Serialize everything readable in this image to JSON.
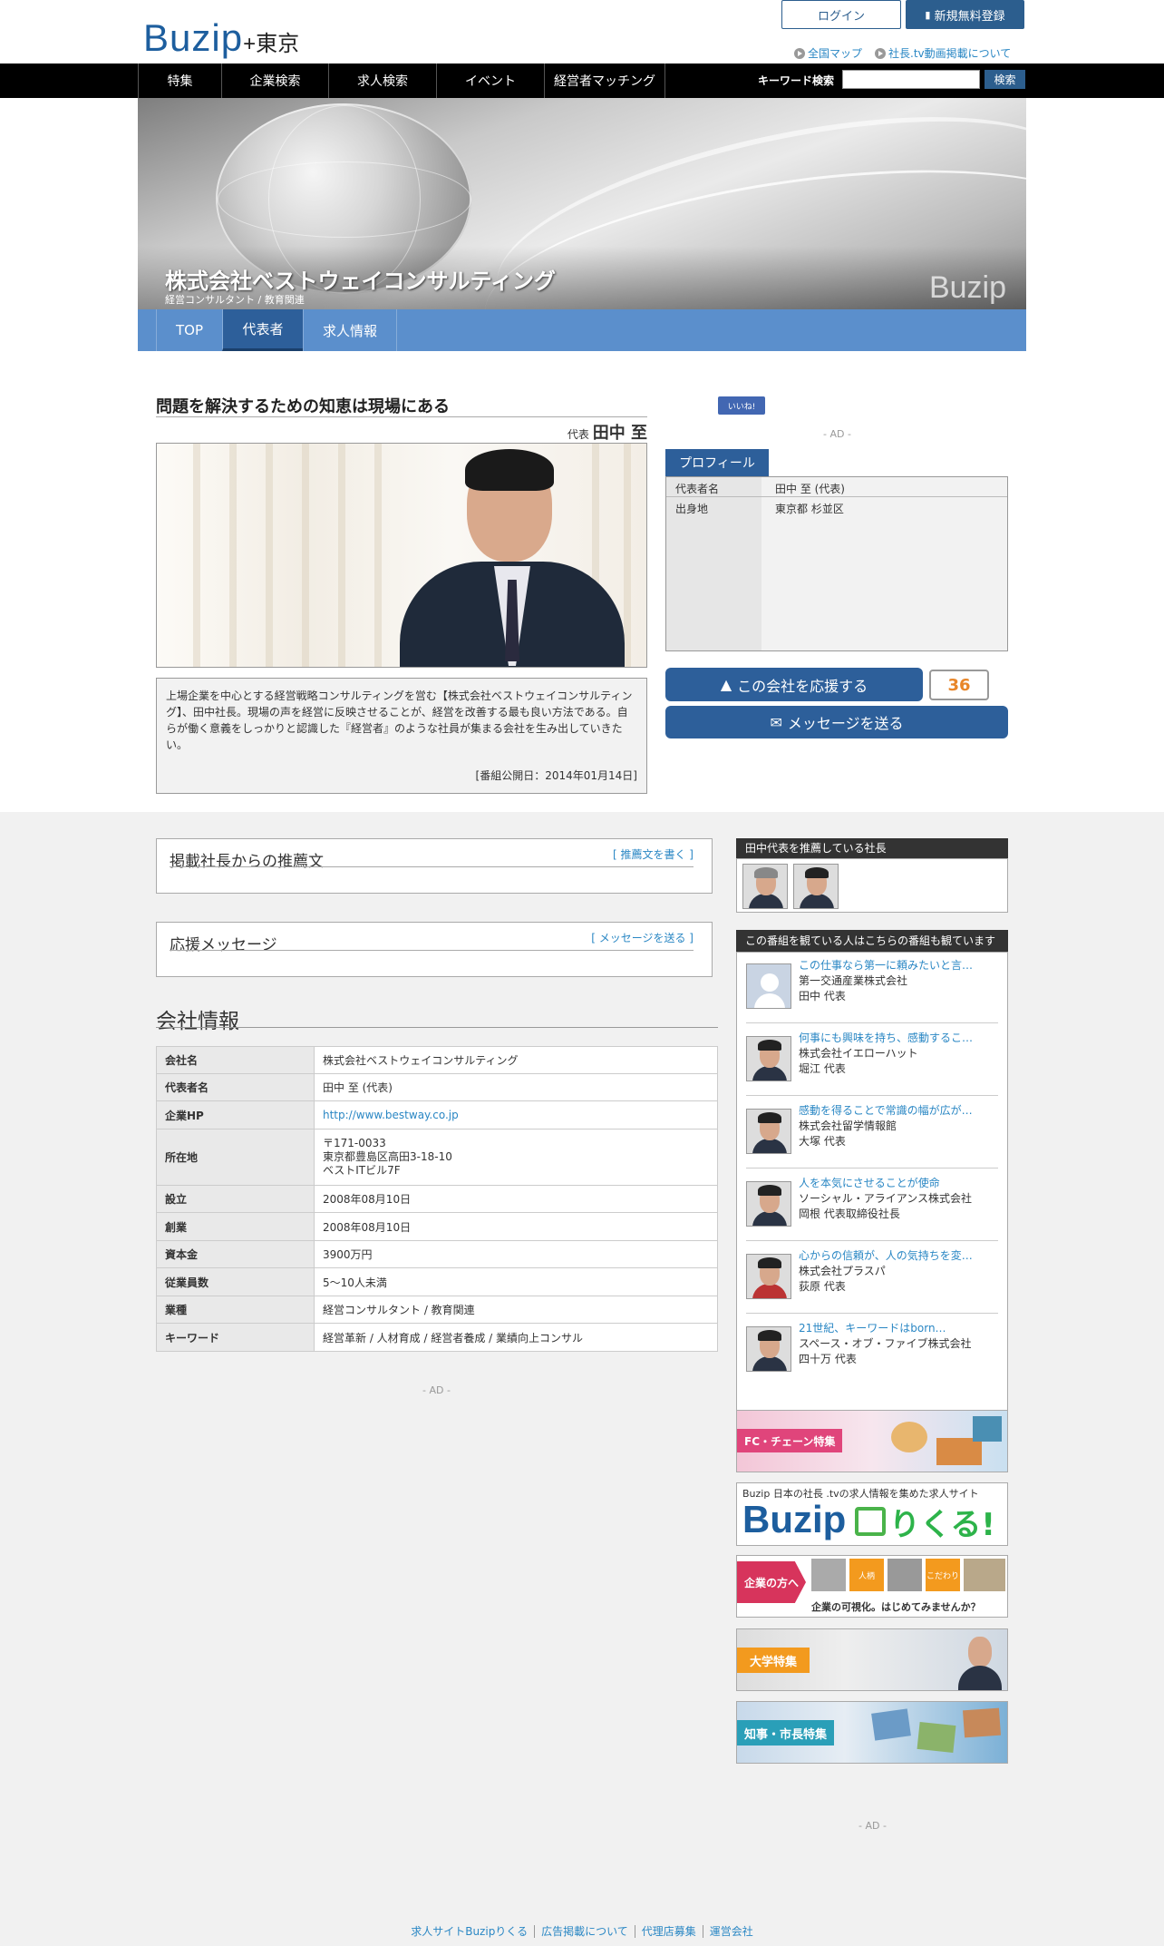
{
  "header": {
    "logo_main": "Buzip",
    "logo_plus": "+東京",
    "login_label": "ログイン",
    "register_label": "新規無料登録",
    "link_map": "全国マップ",
    "link_tv": "社長.tv動画掲載について"
  },
  "nav": {
    "items": [
      "特集",
      "企業検索",
      "求人検索",
      "イベント",
      "経営者マッチング"
    ],
    "keyword_label": "キーワード検索",
    "search_button": "検索",
    "search_value": ""
  },
  "hero": {
    "company": "株式会社ベストウェイコンサルティング",
    "category": "経営コンサルタント / 教育関連",
    "watermark": "Buzip"
  },
  "tabs": [
    "TOP",
    "代表者",
    "求人情報"
  ],
  "main": {
    "headline": "問題を解決するための知恵は現場にある",
    "rep_prefix": "代表",
    "rep_name": "田中 至",
    "description": "上場企業を中心とする経営戦略コンサルティングを営む【株式会社ベストウェイコンサルティング】、田中社長。現場の声を経営に反映させることが、経営を改善する最も良い方法である。自らが働く意義をしっかりと認識した『経営者』のような社員が集まる会社を生み出していきたい。",
    "date": "[番組公開日：2014年01月14日]"
  },
  "sidebar_top": {
    "like_label": "いいね!",
    "ad": "- AD -",
    "profile_tab": "プロフィール",
    "profile": [
      {
        "k": "代表者名",
        "v": "田中 至 (代表)"
      },
      {
        "k": "出身地",
        "v": "東京都 杉並区"
      }
    ],
    "support_label": "この会社を応援する",
    "support_count": "36",
    "message_label": "メッセージを送る"
  },
  "recommend": {
    "title": "掲載社長からの推薦文",
    "link": "[ 推薦文を書く ]"
  },
  "cheer": {
    "title": "応援メッセージ",
    "link": "[ メッセージを送る ]"
  },
  "company": {
    "title": "会社情報",
    "rows": [
      {
        "k": "会社名",
        "v": "株式会社ベストウェイコンサルティング"
      },
      {
        "k": "代表者名",
        "v": "田中 至 (代表)"
      },
      {
        "k": "企業HP",
        "v": "http://www.bestway.co.jp"
      },
      {
        "k": "所在地",
        "v": "〒171-0033\n東京都豊島区高田3-18-10\nベストITビル7F"
      },
      {
        "k": "設立",
        "v": "2008年08月10日"
      },
      {
        "k": "創業",
        "v": "2008年08月10日"
      },
      {
        "k": "資本金",
        "v": "3900万円"
      },
      {
        "k": "従業員数",
        "v": "5〜10人未満"
      },
      {
        "k": "業種",
        "v": "経営コンサルタント / 教育関連"
      },
      {
        "k": "キーワード",
        "v": "経営革新 / 人材育成 / 経営者養成 / 業績向上コンサル"
      }
    ],
    "ad": "- AD -"
  },
  "side": {
    "recommenders_title": "田中代表を推薦している社長",
    "watching_title": "この番組を観ている人はこちらの番組も観ています",
    "watching": [
      {
        "title": "この仕事なら第一に頼みたいと言…",
        "company": "第一交通産業株式会社",
        "name": "田中 代表"
      },
      {
        "title": "何事にも興味を持ち、感動するこ…",
        "company": "株式会社イエローハット",
        "name": "堀江 代表"
      },
      {
        "title": "感動を得ることで常識の幅が広が…",
        "company": "株式会社留学情報館",
        "name": "大塚 代表"
      },
      {
        "title": "人を本気にさせることが使命",
        "company": "ソーシャル・アライアンス株式会社",
        "name": "岡根 代表取締役社長"
      },
      {
        "title": "心からの信頼が、人の気持ちを変…",
        "company": "株式会社プラスパ",
        "name": "荻原 代表"
      },
      {
        "title": "21世紀、キーワードはborn…",
        "company": "スペース・オブ・ファイブ株式会社",
        "name": "四十万 代表"
      }
    ],
    "banner_fc": "FC・チェーン特集",
    "banner_rikuru_top": "Buzip 日本の社長 .tvの求人情報を集めた求人サイト",
    "banner_rikuru_logo": "Buzip",
    "banner_rikuru_word": "りくる!",
    "banner_corp_left": "企業の方へ",
    "banner_corp_tag1": "人柄",
    "banner_corp_tag2": "こだわり",
    "banner_corp_text": "企業の可視化。はじめてみませんか？",
    "banner_univ": "大学特集",
    "banner_gov": "知事・市長特集",
    "ad": "- AD -"
  },
  "footer": {
    "links": [
      "求人サイトBuzipりくる",
      "広告掲載について",
      "代理店募集",
      "運営会社"
    ]
  },
  "colors": {
    "navy": "#2d5f9a",
    "tabbar": "#5b8fcc",
    "link": "#2a87c4",
    "count": "#e8862a"
  }
}
